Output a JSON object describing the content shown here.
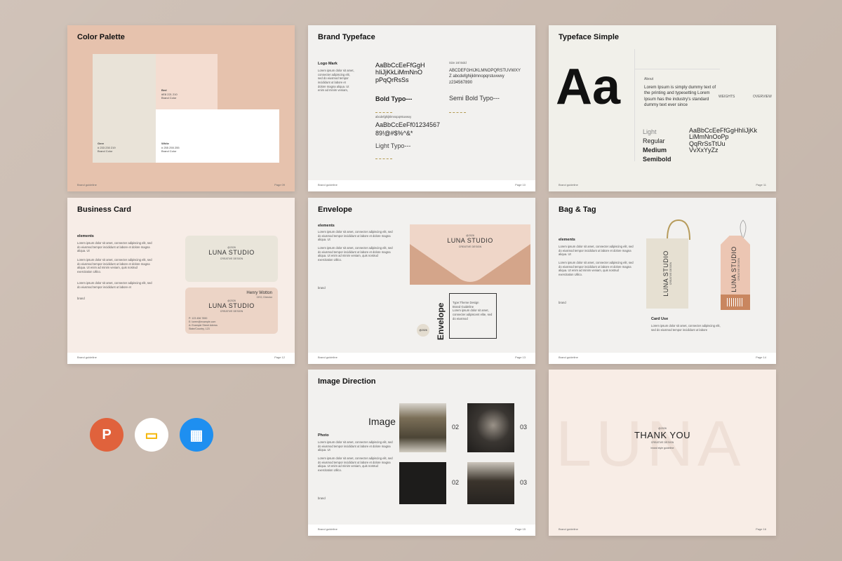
{
  "common": {
    "footer_left": "Brand guideline"
  },
  "s1": {
    "title": "Color Palette",
    "page": "Page 09",
    "beed": {
      "name": "Bed",
      "hex": "#E8 221 210",
      "sub": "Brand Color"
    },
    "gere": {
      "name": "Gere",
      "hex": "# 233 230 219",
      "sub": "Brand Color"
    },
    "white": {
      "name": "White",
      "hex": "# 255 255 255",
      "sub": "Brand Color"
    }
  },
  "s2": {
    "title": "Brand Typeface",
    "page": "Page 10",
    "logo_mark": "Logo Mark",
    "lorem": "Lorem ipsum dolor sit amet, connecter adipiscing elit, sed do eiusmod tempor incididunt ut labore et dolore magna aliqua. Ut enim ad minim veniam,",
    "aa1": "AaBbCcEeFfGgH",
    "aa2": "hIiJjKkLiMmNnO",
    "aa3": "pPqQrRsSs",
    "bold": "Bold Typo---",
    "size_label": "Size 16/ Bold",
    "upper": "ABCDEFGHIJKLMNOPQRSTUVWXY",
    "lower": "Z abcdefghijklmnopqrstuvwxy",
    "digits": "z234567890",
    "semibold": "Semi Bold Typo---",
    "abc2": "abcdefghijklmnopqrstuvwxy",
    "line1": "AaBbCcEeFf01234567",
    "line2": "89!@#$%^&*",
    "light": "Light Typo---"
  },
  "s3": {
    "title": "Typeface Simple",
    "page": "Page 11",
    "big": "Aa",
    "about": "About",
    "about_text": "Lorem Ipsum is simply dummy text of the printing and typesetting Lorem Ipsum has the industry's standard dummy text ever since",
    "weights": "WEIGHTS",
    "overview": "OVERVIEW",
    "w_light": "Light",
    "w_regular": "Regular",
    "w_medium": "Medium",
    "w_semibold": "Semibold",
    "s1": "AaBbCcEeFfGgHhIiJjKk",
    "s2": "LiMmNnOoPp",
    "s3": "QqRrSsTtUu",
    "s4": "VvXxYyZz"
  },
  "s4": {
    "title": "Business Card",
    "page": "Page 12",
    "elements": "elements",
    "lorem": "Lorem ipsum dolor sit amet, connecter adipiscing elit, sed do eiusmod tempor incididunt ut labore et dolore magna aliqua. Ut",
    "lorem2": "Lorem ipsum dolor sit amet, connecter adipiscing elit, sed do eiusmod tempor incididunt ut labore et dolore magna aliqua. Ut enim ad minim veniam, quis nostrud exercitation Ulilco.",
    "lorem3": "Lorem ipsum dolor sit amet, connecter adipiscing elit, sed do eiusmod tempor incididunt ut labore et",
    "brand_word": "brand",
    "at": "@2026",
    "studio": "LUNA STUDIO",
    "creative": "CREATIVE DESIGN",
    "person": "Henry Wotton",
    "role": "CEO, Director",
    "phone": "P: 123 456 7890",
    "email": "E: lorem@example.com",
    "addr1": "A: Example Street Adress",
    "addr2": "State/Country, 123"
  },
  "s5": {
    "title": "Envelope",
    "page": "Page 13",
    "elements": "elements",
    "lorem": "Lorem ipsum dolor sit amet, connecter adipiscing elit, sed do eiusmod tempor incididunt ut labore et dolore magna aliqua. Ut",
    "lorem2": "Lorem ipsum dolor sit amet, connecter adipiscing elit, sed do eiusmod tempor incididunt ut labore et dolore magna aliqua. Ut enim ad minim veniam, quis nostrud exercitation Ulilco.",
    "brand_word": "brand",
    "at": "@2026",
    "studio": "LUNA STUDIO",
    "creative": "CREATIVE DESIGN",
    "vertical": "Envelope",
    "box1": "Type:Theme Design",
    "box2": "Brand Guideline",
    "box3": "Lorem ipsum dolor sit amet, connecter adipiscent elite, sed do eiusmod",
    "stamp": "@2026"
  },
  "s6": {
    "title": "Bag & Tag",
    "page": "Page 14",
    "elements": "elements",
    "lorem": "Lorem ipsum dolor sit amet, connecter adipiscing elit, sed do eiusmod tempor incididunt ut labore et dolore magna aliqua. Ut",
    "lorem2": "Lorem ipsum dolor sit amet, connecter adipiscing elit, sed do eiusmod tempor incididunt ut labore et dolore magna aliqua. Ut enim ad minim veniam, quis nostrud exercitation Ulilco.",
    "brand_word": "brand",
    "studio": "LUNA STUDIO",
    "creative": "CREATIVE DESIGN",
    "card_use": "Card Use",
    "card_text": "Lorem ipsum dolor sit amet, connecter adipiscing elit, sed do eiusmod tempor incididunt ut labore"
  },
  "s7": {
    "title": "Image Direction",
    "page": "Page 15",
    "image_word": "Image",
    "photo": "Photo",
    "lorem": "Lorem ipsum dolor sit amet, connecter adipiscing elit, sed do eiusmod tempor incididunt ut labore et dolore magna aliqua. Ut",
    "lorem2": "Lorem ipsum dolor sit amet, connecter adipiscing elit, sed do eiusmod tempor incididunt ut labore et dolore magna aliqua. Ut enim ad minim veniam, quis nostrud exercitation Ulilco.",
    "brand_word": "brand",
    "n1": "02",
    "n2": "03",
    "n3": "02",
    "n4": "03"
  },
  "s8": {
    "big": "LUNA",
    "at": "@2026",
    "thanks": "THANK YOU",
    "creative": "CREATIVE DESIGN",
    "guide": "brand style guideline",
    "page": "Page 16"
  },
  "apps": {
    "ppt": "P",
    "slides": "▭",
    "keynote": "▦",
    "colors": {
      "ppt": "#e0623c",
      "slides": "#f5b400",
      "keynote": "#1e8ff0"
    }
  }
}
